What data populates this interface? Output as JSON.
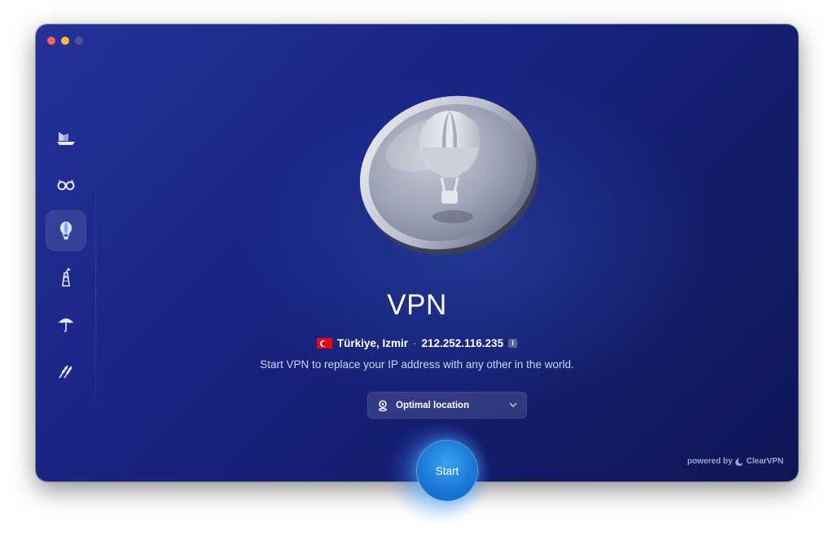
{
  "window": {
    "traffic_lights": [
      "close",
      "minimize",
      "zoom"
    ]
  },
  "sidebar": {
    "items": [
      {
        "icon": "ship-icon",
        "active": false
      },
      {
        "icon": "glasses-icon",
        "active": false
      },
      {
        "icon": "balloon-icon",
        "active": true
      },
      {
        "icon": "tower-icon",
        "active": false
      },
      {
        "icon": "umbrella-icon",
        "active": false
      },
      {
        "icon": "wheat-icon",
        "active": false
      }
    ]
  },
  "main": {
    "hero_icon": "hot-air-balloon-coin-icon",
    "title": "VPN",
    "location": {
      "flag": "turkey-flag-icon",
      "place": "Türkiye, Izmir",
      "separator": "·",
      "ip": "212.252.116.235",
      "info_glyph": "i"
    },
    "subtitle": "Start VPN to replace your IP address with any other in the world.",
    "location_select": {
      "icon": "location-pin-icon",
      "value": "Optimal location"
    },
    "start_button": "Start"
  },
  "footer": {
    "powered_prefix": "powered by",
    "brand": "ClearVPN"
  },
  "colors": {
    "accent_blue": "#1b79d6",
    "background_dark": "#141d6e"
  }
}
